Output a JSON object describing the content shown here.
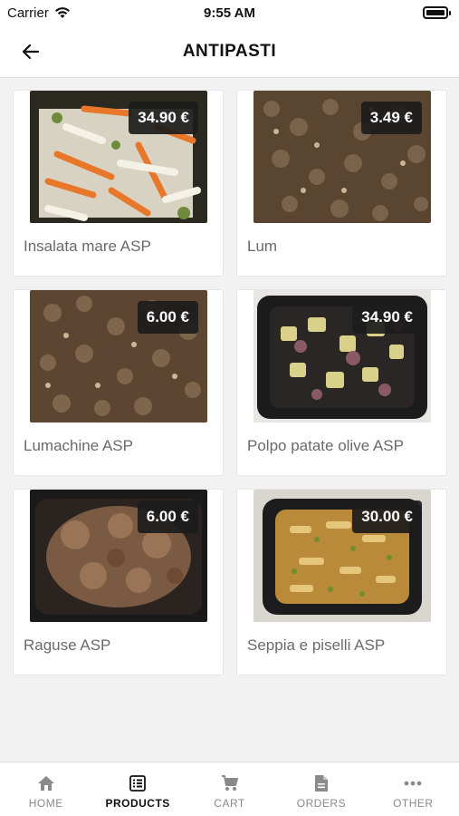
{
  "status_bar": {
    "carrier": "Carrier",
    "time": "9:55 AM"
  },
  "header": {
    "title": "ANTIPASTI",
    "back_icon": "arrow-left-icon"
  },
  "products": [
    {
      "name": "Insalata mare ASP",
      "price": "34.90 €",
      "image": "seafood-salad"
    },
    {
      "name": "Lum",
      "price": "3.49 €",
      "image": "snails"
    },
    {
      "name": "Lumachine ASP",
      "price": "6.00 €",
      "image": "snails"
    },
    {
      "name": "Polpo patate olive ASP",
      "price": "34.90 €",
      "image": "octopus-potatoes"
    },
    {
      "name": "Raguse ASP",
      "price": "6.00 €",
      "image": "stew"
    },
    {
      "name": "Seppia e piselli ASP",
      "price": "30.00 €",
      "image": "cuttlefish-peas"
    }
  ],
  "tabs": [
    {
      "label": "HOME",
      "icon": "home-icon",
      "active": false
    },
    {
      "label": "PRODUCTS",
      "icon": "list-icon",
      "active": true
    },
    {
      "label": "CART",
      "icon": "cart-icon",
      "active": false
    },
    {
      "label": "ORDERS",
      "icon": "document-icon",
      "active": false
    },
    {
      "label": "OTHER",
      "icon": "more-icon",
      "active": false
    }
  ],
  "colors": {
    "active_tab": "#111111",
    "inactive_tab": "#8a8a8a",
    "price_badge": "#1c1c1c"
  }
}
